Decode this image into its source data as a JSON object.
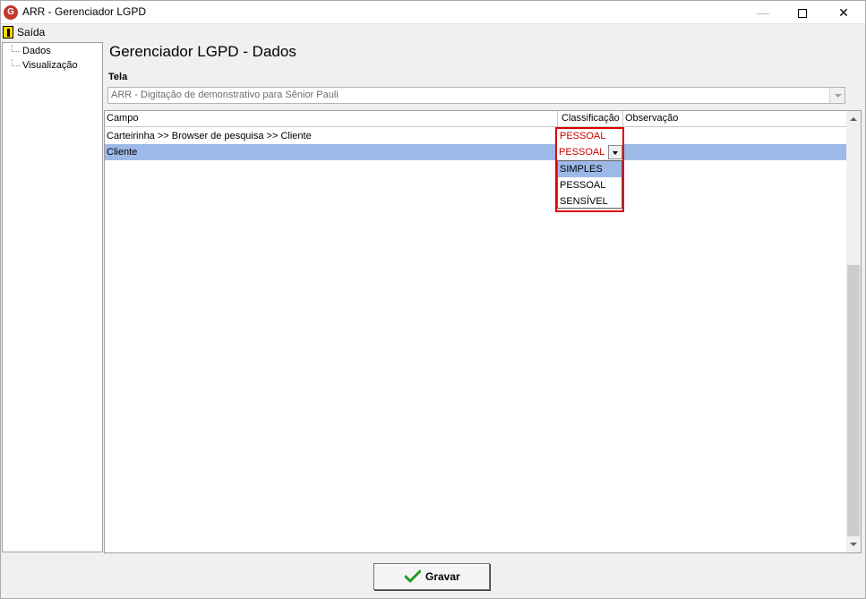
{
  "window": {
    "title": "ARR - Gerenciador LGPD"
  },
  "menu": {
    "exit_label": "Saída"
  },
  "tree": {
    "items": [
      {
        "label": "Dados"
      },
      {
        "label": "Visualização"
      }
    ]
  },
  "main": {
    "page_title": "Gerenciador LGPD - Dados",
    "tela_label": "Tela",
    "tela_value": "ARR - Digitação de demonstrativo para Sênior Pauli"
  },
  "grid": {
    "columns": [
      "Campo",
      "Classificação",
      "Observação"
    ],
    "rows": [
      {
        "campo": "Carteirinha >> Browser de pesquisa >> Cliente",
        "classificacao": "PESSOAL",
        "observacao": ""
      },
      {
        "campo": "Cliente",
        "classificacao": "PESSOAL",
        "observacao": ""
      }
    ],
    "dropdown_options": [
      "SIMPLES",
      "PESSOAL",
      "SENSÍVEL"
    ],
    "selected_option": "SIMPLES"
  },
  "footer": {
    "save_label": "Gravar"
  },
  "colors": {
    "selection": "#9db9e8",
    "highlight_border": "#e00000",
    "classification_text": "#cc0000",
    "save_check": "#1e9e1e"
  }
}
